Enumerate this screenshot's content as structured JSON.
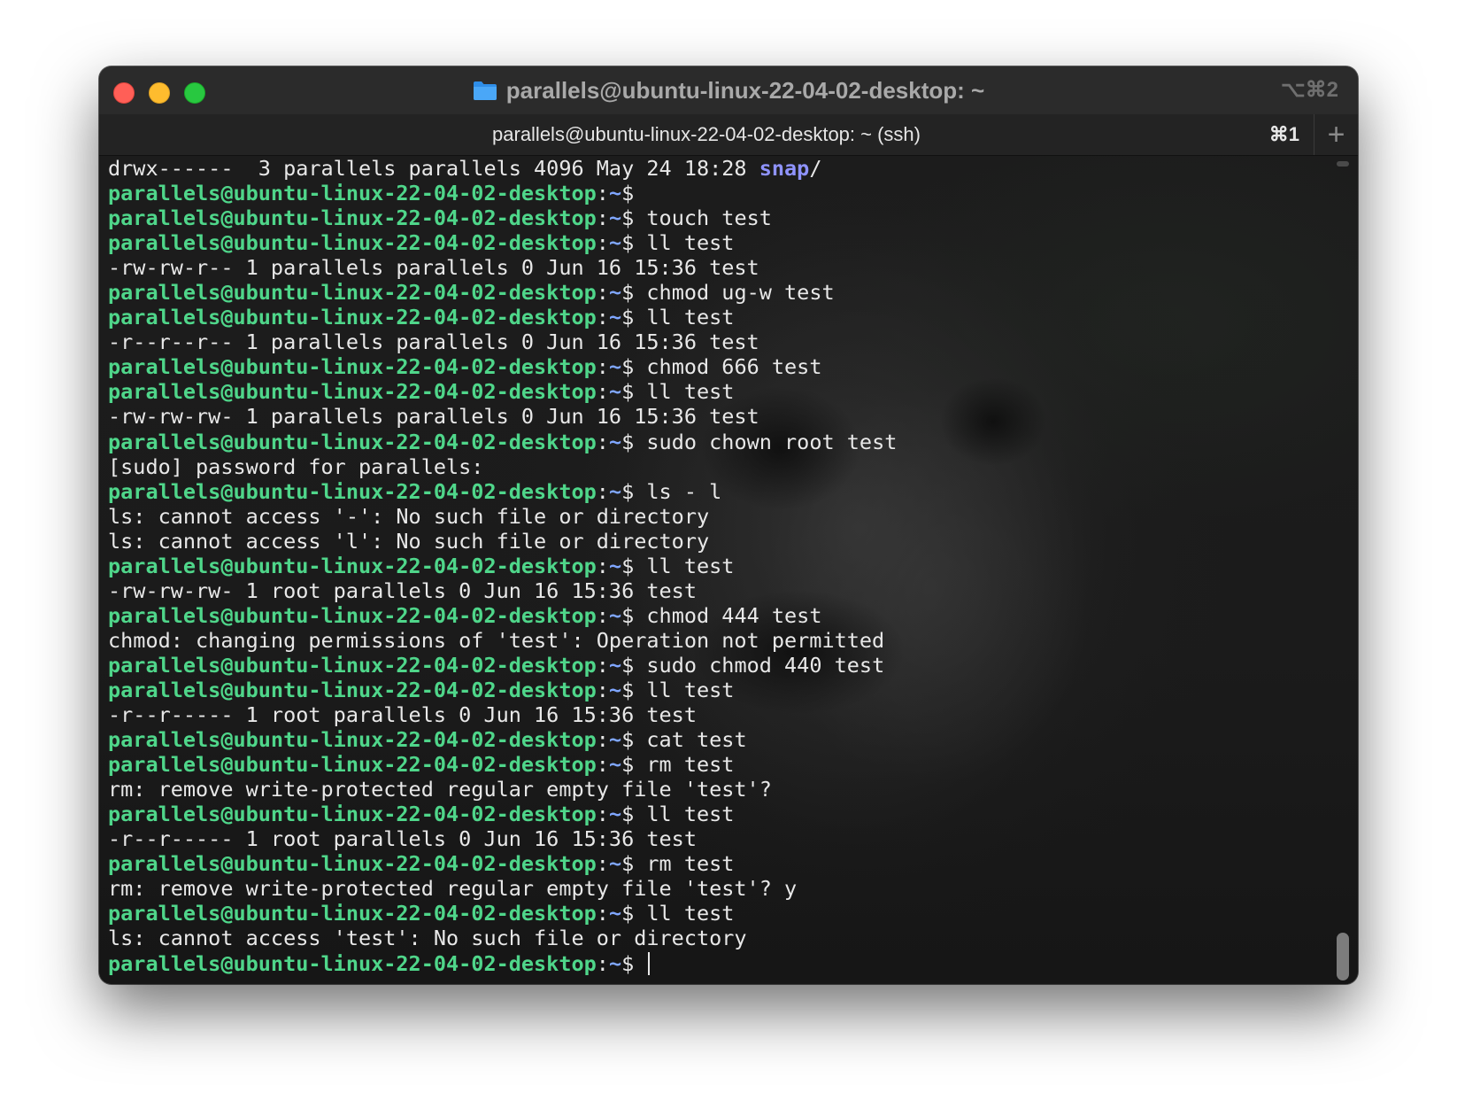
{
  "window": {
    "title": "parallels@ubuntu-linux-22-04-02-desktop: ~",
    "window_shortcut": "⌥⌘2"
  },
  "tabs": [
    {
      "label": "parallels@ubuntu-linux-22-04-02-desktop: ~ (ssh)",
      "shortcut": "⌘1"
    }
  ],
  "new_tab_label": "+",
  "prompt": {
    "host": "parallels@ubuntu-linux-22-04-02-desktop",
    "path": "~",
    "symbol": "$"
  },
  "colors": {
    "prompt_host": "#4fd68a",
    "prompt_path": "#7fa6ff",
    "text": "#e8e8e8",
    "directory": "#8f93ff"
  },
  "lines": [
    {
      "kind": "output",
      "text": "drwx------  3 parallels parallels 4096 May 24 18:28 ",
      "dir": "snap",
      "suffix": "/"
    },
    {
      "kind": "prompt",
      "command": ""
    },
    {
      "kind": "prompt",
      "command": "touch test"
    },
    {
      "kind": "prompt",
      "command": "ll test"
    },
    {
      "kind": "output",
      "text": "-rw-rw-r-- 1 parallels parallels 0 Jun 16 15:36 test"
    },
    {
      "kind": "prompt",
      "command": "chmod ug-w test"
    },
    {
      "kind": "prompt",
      "command": "ll test"
    },
    {
      "kind": "output",
      "text": "-r--r--r-- 1 parallels parallels 0 Jun 16 15:36 test"
    },
    {
      "kind": "prompt",
      "command": "chmod 666 test"
    },
    {
      "kind": "prompt",
      "command": "ll test"
    },
    {
      "kind": "output",
      "text": "-rw-rw-rw- 1 parallels parallels 0 Jun 16 15:36 test"
    },
    {
      "kind": "prompt",
      "command": "sudo chown root test"
    },
    {
      "kind": "output",
      "text": "[sudo] password for parallels:"
    },
    {
      "kind": "prompt",
      "command": "ls - l"
    },
    {
      "kind": "output",
      "text": "ls: cannot access '-': No such file or directory"
    },
    {
      "kind": "output",
      "text": "ls: cannot access 'l': No such file or directory"
    },
    {
      "kind": "prompt",
      "command": "ll test"
    },
    {
      "kind": "output",
      "text": "-rw-rw-rw- 1 root parallels 0 Jun 16 15:36 test"
    },
    {
      "kind": "prompt",
      "command": "chmod 444 test"
    },
    {
      "kind": "output",
      "text": "chmod: changing permissions of 'test': Operation not permitted"
    },
    {
      "kind": "prompt",
      "command": "sudo chmod 440 test"
    },
    {
      "kind": "prompt",
      "command": "ll test"
    },
    {
      "kind": "output",
      "text": "-r--r----- 1 root parallels 0 Jun 16 15:36 test"
    },
    {
      "kind": "prompt",
      "command": "cat test"
    },
    {
      "kind": "prompt",
      "command": "rm test"
    },
    {
      "kind": "output",
      "text": "rm: remove write-protected regular empty file 'test'?"
    },
    {
      "kind": "prompt",
      "command": "ll test"
    },
    {
      "kind": "output",
      "text": "-r--r----- 1 root parallels 0 Jun 16 15:36 test"
    },
    {
      "kind": "prompt",
      "command": "rm test"
    },
    {
      "kind": "output",
      "text": "rm: remove write-protected regular empty file 'test'? y"
    },
    {
      "kind": "prompt",
      "command": "ll test"
    },
    {
      "kind": "output",
      "text": "ls: cannot access 'test': No such file or directory"
    },
    {
      "kind": "prompt",
      "command": "",
      "cursor": true
    }
  ]
}
